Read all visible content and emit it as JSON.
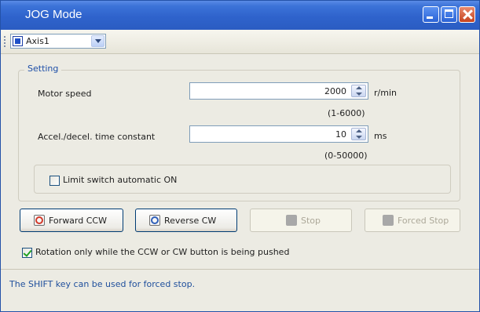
{
  "window": {
    "title": "JOG Mode"
  },
  "toolbar": {
    "axis_selected": "Axis1"
  },
  "setting": {
    "group_label": "Setting",
    "motor_speed": {
      "label": "Motor speed",
      "value": "2000",
      "unit": "r/min",
      "range": "(1-6000)"
    },
    "accel": {
      "label": "Accel./decel. time constant",
      "value": "10",
      "unit": "ms",
      "range": "(0-50000)"
    },
    "limit_switch": {
      "label": "Limit switch automatic ON",
      "checked": false
    }
  },
  "buttons": {
    "forward": {
      "label": "Forward CCW",
      "icon": "forward-ccw-icon",
      "enabled": true
    },
    "reverse": {
      "label": "Reverse CW",
      "icon": "reverse-cw-icon",
      "enabled": true
    },
    "stop": {
      "label": "Stop",
      "icon": "stop-icon",
      "enabled": false
    },
    "forced_stop": {
      "label": "Forced Stop",
      "icon": "forced-stop-icon",
      "enabled": false
    }
  },
  "rotation_option": {
    "label": "Rotation only while the CCW or CW button is being pushed",
    "checked": true
  },
  "status": {
    "message": "The SHIFT key can be used for forced stop."
  },
  "colors": {
    "title_bar": "#2f63cc",
    "accent_text": "#1e4fa8",
    "window_bg": "#ecebe3"
  }
}
